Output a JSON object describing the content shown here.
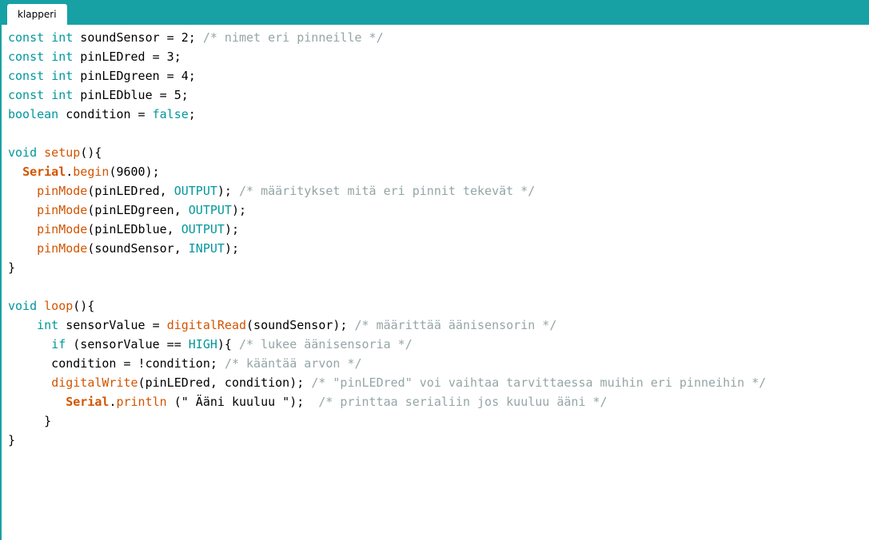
{
  "tab": {
    "label": "klapperi"
  },
  "colors": {
    "accent": "#17a1a5",
    "keyword": "#00979c",
    "function": "#d35400",
    "constant": "#00979c",
    "comment": "#95a5a6",
    "text": "#000000"
  },
  "code": {
    "lines": [
      [
        [
          "keyword",
          "const"
        ],
        [
          "text",
          " "
        ],
        [
          "keyword",
          "int"
        ],
        [
          "text",
          " soundSensor = 2; "
        ],
        [
          "comment",
          "/* nimet eri pinneille */"
        ]
      ],
      [
        [
          "keyword",
          "const"
        ],
        [
          "text",
          " "
        ],
        [
          "keyword",
          "int"
        ],
        [
          "text",
          " pinLEDred = 3;"
        ]
      ],
      [
        [
          "keyword",
          "const"
        ],
        [
          "text",
          " "
        ],
        [
          "keyword",
          "int"
        ],
        [
          "text",
          " pinLEDgreen = 4;"
        ]
      ],
      [
        [
          "keyword",
          "const"
        ],
        [
          "text",
          " "
        ],
        [
          "keyword",
          "int"
        ],
        [
          "text",
          " pinLEDblue = 5;"
        ]
      ],
      [
        [
          "keyword",
          "boolean"
        ],
        [
          "text",
          " condition = "
        ],
        [
          "keyword",
          "false"
        ],
        [
          "text",
          ";"
        ]
      ],
      [],
      [
        [
          "keyword",
          "void"
        ],
        [
          "text",
          " "
        ],
        [
          "func",
          "setup"
        ],
        [
          "text",
          "(){"
        ]
      ],
      [
        [
          "text",
          "  "
        ],
        [
          "class",
          "Serial"
        ],
        [
          "text",
          "."
        ],
        [
          "func",
          "begin"
        ],
        [
          "text",
          "(9600);"
        ]
      ],
      [
        [
          "text",
          "    "
        ],
        [
          "func",
          "pinMode"
        ],
        [
          "text",
          "(pinLEDred, "
        ],
        [
          "const",
          "OUTPUT"
        ],
        [
          "text",
          "); "
        ],
        [
          "comment",
          "/* määritykset mitä eri pinnit tekevät */"
        ]
      ],
      [
        [
          "text",
          "    "
        ],
        [
          "func",
          "pinMode"
        ],
        [
          "text",
          "(pinLEDgreen, "
        ],
        [
          "const",
          "OUTPUT"
        ],
        [
          "text",
          ");"
        ]
      ],
      [
        [
          "text",
          "    "
        ],
        [
          "func",
          "pinMode"
        ],
        [
          "text",
          "(pinLEDblue, "
        ],
        [
          "const",
          "OUTPUT"
        ],
        [
          "text",
          ");"
        ]
      ],
      [
        [
          "text",
          "    "
        ],
        [
          "func",
          "pinMode"
        ],
        [
          "text",
          "(soundSensor, "
        ],
        [
          "const",
          "INPUT"
        ],
        [
          "text",
          ");"
        ]
      ],
      [
        [
          "text",
          "}"
        ]
      ],
      [],
      [
        [
          "keyword",
          "void"
        ],
        [
          "text",
          " "
        ],
        [
          "func",
          "loop"
        ],
        [
          "text",
          "(){"
        ]
      ],
      [
        [
          "text",
          "    "
        ],
        [
          "keyword",
          "int"
        ],
        [
          "text",
          " sensorValue = "
        ],
        [
          "func",
          "digitalRead"
        ],
        [
          "text",
          "(soundSensor); "
        ],
        [
          "comment",
          "/* määrittää äänisensorin */"
        ]
      ],
      [
        [
          "text",
          "      "
        ],
        [
          "keyword",
          "if"
        ],
        [
          "text",
          " (sensorValue == "
        ],
        [
          "const",
          "HIGH"
        ],
        [
          "text",
          "){ "
        ],
        [
          "comment",
          "/* lukee äänisensoria */"
        ]
      ],
      [
        [
          "text",
          "      condition = !condition; "
        ],
        [
          "comment",
          "/* kääntää arvon */"
        ]
      ],
      [
        [
          "text",
          "      "
        ],
        [
          "func",
          "digitalWrite"
        ],
        [
          "text",
          "(pinLEDred, condition); "
        ],
        [
          "comment",
          "/* \"pinLEDred\" voi vaihtaa tarvittaessa muihin eri pinneihin */"
        ]
      ],
      [
        [
          "text",
          "        "
        ],
        [
          "class",
          "Serial"
        ],
        [
          "text",
          "."
        ],
        [
          "func",
          "println"
        ],
        [
          "text",
          " (\" Ääni kuuluu \");  "
        ],
        [
          "comment",
          "/* printtaa serialiin jos kuuluu ääni */"
        ]
      ],
      [
        [
          "text",
          "     }"
        ]
      ],
      [
        [
          "text",
          "}"
        ]
      ]
    ]
  }
}
